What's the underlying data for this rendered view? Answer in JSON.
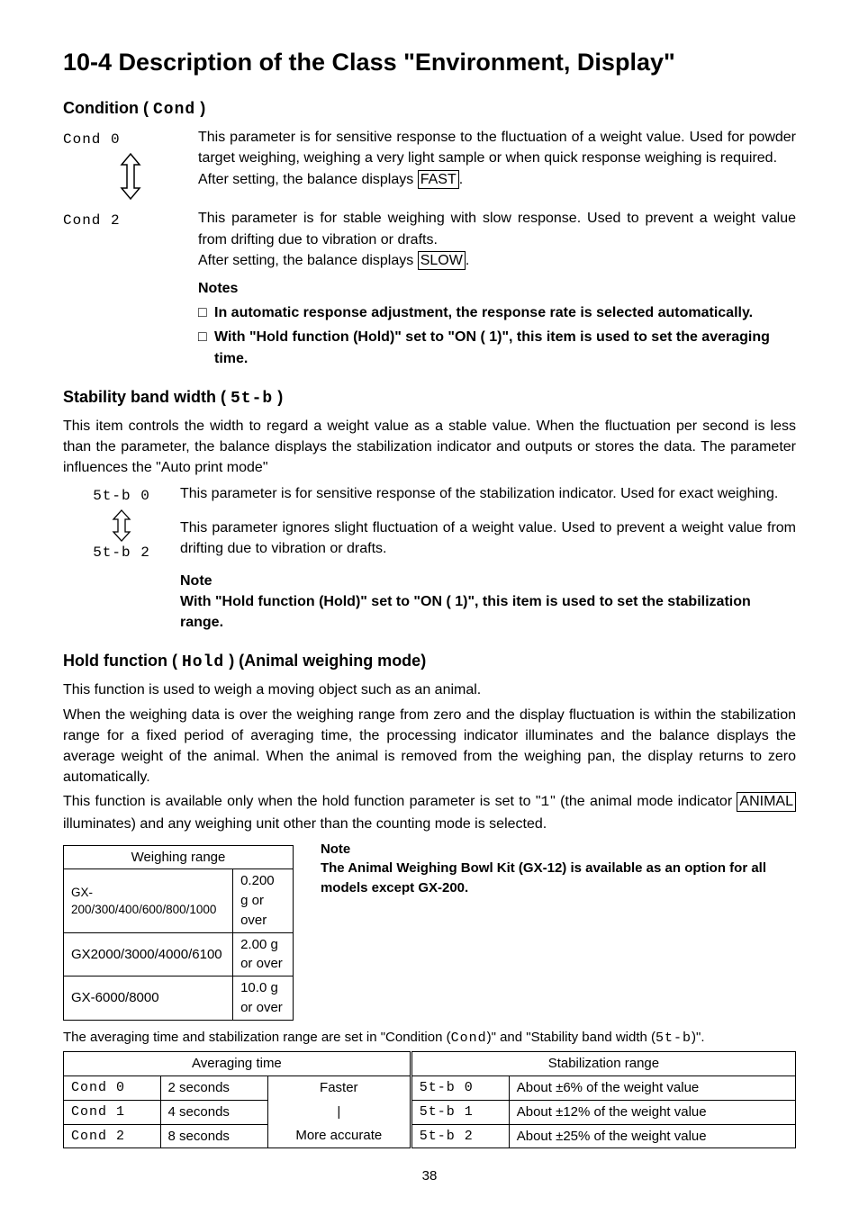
{
  "h1": "10-4  Description of the Class \"Environment, Display\"",
  "cond_heading_pre": "Condition ( ",
  "cond_heading_seg": "Cond",
  "cond_heading_post": " )",
  "cond0_label": "Cond 0",
  "cond0_text_a": "This parameter is for sensitive response to the fluctuation of a weight value. Used for powder target weighing, weighing a very light sample or when quick response weighing is required.",
  "cond0_text_b_pre": "After setting, the balance displays ",
  "cond0_text_b_box": "FAST",
  "cond0_text_b_post": ".",
  "cond2_label": "Cond 2",
  "cond2_text_a": "This parameter is for stable weighing with slow response. Used to prevent a weight value from drifting due to vibration or drafts.",
  "cond2_text_b_pre": "After setting, the balance displays ",
  "cond2_text_b_box": "SLOW",
  "cond2_text_b_post": ".",
  "notes_title": "Notes",
  "notes_items": [
    "In automatic response adjustment, the response rate is selected automatically.",
    "With \"Hold function (Hold)\" set to \"ON ( 1)\", this item is used to set the averaging time."
  ],
  "stab_heading_pre": "Stability band width ( ",
  "stab_heading_seg": "5t-b",
  "stab_heading_post": " )",
  "stab_intro": "This item controls the width to regard a weight value as a stable value. When the fluctuation per second is less than the parameter, the balance displays the stabilization indicator and outputs or stores the data. The parameter influences the \"Auto print mode\"",
  "stab0_label": "5t-b 0",
  "stab0_text": "This parameter is for sensitive response of the stabilization indicator. Used for exact weighing.",
  "stab2_label": "5t-b 2",
  "stab2_text": "This parameter ignores slight fluctuation of a weight value. Used to prevent a weight value from drifting due to vibration or drafts.",
  "stab_note_title": "Note",
  "stab_note_body": "With \"Hold function (Hold)\" set to \"ON ( 1)\", this item is used to set the stabilization range.",
  "hold_heading_pre": "Hold function ( ",
  "hold_heading_seg": "Hold",
  "hold_heading_post": " ) (Animal weighing mode)",
  "hold_p1": "This function is used to weigh a moving object such as an animal.",
  "hold_p2": "When the weighing data is over the weighing range from zero and the display fluctuation is within the stabilization range for a fixed period of averaging time, the processing indicator illuminates and the balance displays the average weight of the animal. When the animal is removed from the weighing pan, the display returns to zero automatically.",
  "hold_p3_a": "This function is available only when the hold function parameter is set to \"",
  "hold_p3_seg": "1",
  "hold_p3_b": "\" (the animal mode indicator ",
  "hold_p3_box": "ANIMAL",
  "hold_p3_c": " illuminates) and any weighing unit other than the counting mode is selected.",
  "wr_header": "Weighing range",
  "wr_rows": [
    {
      "a": "GX-200/300/400/600/800/1000",
      "b": "0.200 g or over"
    },
    {
      "a": "GX2000/3000/4000/6100",
      "b": "2.00 g or over"
    },
    {
      "a": "GX-6000/8000",
      "b": "10.0 g or over"
    }
  ],
  "wr_note_title": "Note",
  "wr_note_body": "The Animal Weighing Bowl Kit (GX-12) is available as an option for all models except GX-200.",
  "avg_sentence_a": "The averaging time and stabilization range are set in \"Condition (",
  "avg_sentence_seg1": "Cond",
  "avg_sentence_b": ")\" and \"Stability band width (",
  "avg_sentence_seg2": "5t-b",
  "avg_sentence_c": ")\".",
  "avg_table": {
    "left_header": "Averaging time",
    "right_header": "Stabilization range",
    "rows": [
      {
        "c1": "Cond 0",
        "c2": "2 seconds",
        "c3": "Faster",
        "s1": "5t-b 0",
        "s2": "About ±6% of the weight value"
      },
      {
        "c1": "Cond 1",
        "c2": "4 seconds",
        "c3": "|",
        "s1": "5t-b 1",
        "s2": "About ±12% of the weight value"
      },
      {
        "c1": "Cond 2",
        "c2": "8 seconds",
        "c3": "More accurate",
        "s1": "5t-b 2",
        "s2": "About ±25% of the weight value"
      }
    ]
  },
  "pagenum": "38"
}
